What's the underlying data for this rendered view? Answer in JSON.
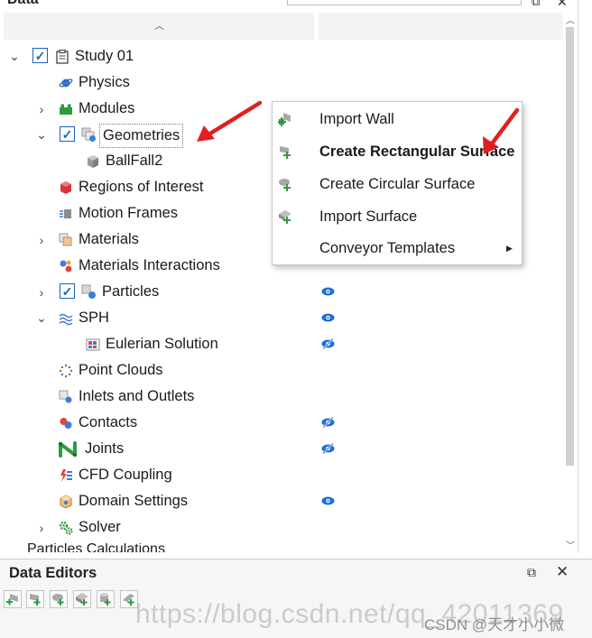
{
  "panel": {
    "title": "Data",
    "sort_indicator": "^"
  },
  "tree": {
    "items": [
      {
        "label": "Study 01",
        "expander": "expanded",
        "checked": true,
        "icon": "clipboard-icon"
      },
      {
        "label": "Physics",
        "icon": "planet-icon"
      },
      {
        "label": "Modules",
        "expander": "collapsed",
        "icon": "modules-icon"
      },
      {
        "label": "Geometries",
        "expander": "expanded",
        "checked": true,
        "icon": "geometries-icon"
      },
      {
        "label": "BallFall2",
        "icon": "geometry-object-icon"
      },
      {
        "label": "Regions of Interest",
        "icon": "region-icon"
      },
      {
        "label": "Motion Frames",
        "icon": "motion-frame-icon"
      },
      {
        "label": "Materials",
        "expander": "collapsed",
        "icon": "materials-icon"
      },
      {
        "label": "Materials Interactions",
        "icon": "interactions-icon"
      },
      {
        "label": "Particles",
        "expander": "collapsed",
        "checked": true,
        "icon": "particles-icon",
        "visibility": "visible"
      },
      {
        "label": "SPH",
        "expander": "expanded",
        "icon": "sph-icon",
        "visibility": "visible"
      },
      {
        "label": "Eulerian Solution",
        "icon": "eulerian-icon",
        "visibility": "hidden"
      },
      {
        "label": "Point Clouds",
        "icon": "point-cloud-icon"
      },
      {
        "label": "Inlets and Outlets",
        "icon": "inlets-icon"
      },
      {
        "label": "Contacts",
        "icon": "contacts-icon",
        "visibility": "hidden"
      },
      {
        "label": "Joints",
        "icon": "joints-icon",
        "visibility": "hidden"
      },
      {
        "label": "CFD Coupling",
        "icon": "cfd-coupling-icon"
      },
      {
        "label": "Domain Settings",
        "icon": "domain-settings-icon",
        "visibility": "visible"
      },
      {
        "label": "Solver",
        "expander": "collapsed",
        "icon": "solver-icon"
      }
    ],
    "cutoff_item": "Particles Calculations"
  },
  "context_menu": {
    "items": [
      {
        "label": "Import Wall",
        "icon": "import-wall-icon"
      },
      {
        "label": "Create Rectangular Surface",
        "icon": "rect-surface-icon"
      },
      {
        "label": "Create Circular Surface",
        "icon": "circular-surface-icon"
      },
      {
        "label": "Import Surface",
        "icon": "import-surface-icon"
      },
      {
        "label": "Conveyor Templates",
        "has_submenu": true
      }
    ]
  },
  "editors": {
    "title": "Data Editors",
    "restore_label": "⧉",
    "close_label": "✕"
  },
  "watermark": {
    "text": "https://blog.csdn.net/qq_42011369",
    "label": "CSDN @天才小小微"
  },
  "colors": {
    "accent": "#1565c0",
    "eye": "#1e6ed8",
    "arrow": "#e02020"
  }
}
